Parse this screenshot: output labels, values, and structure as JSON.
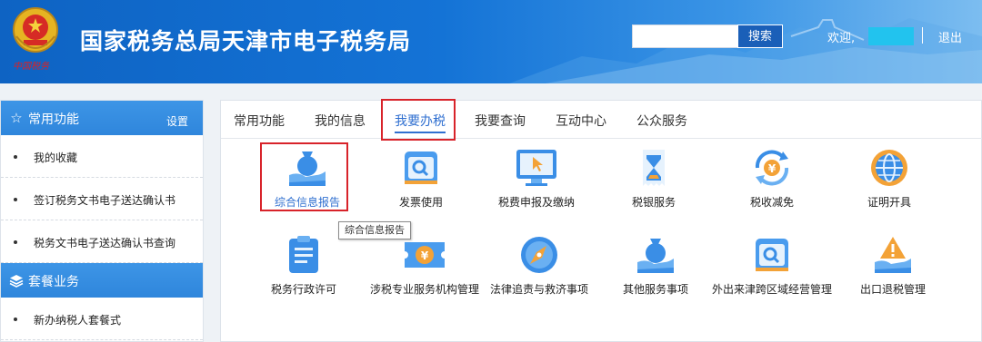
{
  "header": {
    "emblem_text": "中国税务",
    "title": "国家税务总局天津市电子税务局",
    "search_placeholder": "",
    "search_button": "搜索",
    "welcome": "欢迎,",
    "logout": "退出",
    "colors": {
      "primary": "#1473d6",
      "accent": "#22c3ee"
    }
  },
  "sidebar": {
    "sections": [
      {
        "icon": "star-icon",
        "title": "常用功能",
        "action": "设置",
        "items": [
          "我的收藏",
          "签订税务文书电子送达确认书",
          "税务文书电子送达确认书查询"
        ]
      },
      {
        "icon": "layers-icon",
        "title": "套餐业务",
        "items": [
          "新办纳税人套餐式"
        ]
      }
    ]
  },
  "tabs": [
    {
      "label": "常用功能",
      "active": false
    },
    {
      "label": "我的信息",
      "active": false
    },
    {
      "label": "我要办税",
      "active": true
    },
    {
      "label": "我要查询",
      "active": false
    },
    {
      "label": "互动中心",
      "active": false
    },
    {
      "label": "公众服务",
      "active": false
    }
  ],
  "services": [
    {
      "icon": "money-bag-hand-icon",
      "label": "综合信息报告"
    },
    {
      "icon": "invoice-search-icon",
      "label": "发票使用"
    },
    {
      "icon": "monitor-cursor-icon",
      "label": "税费申报及缴纳"
    },
    {
      "icon": "hourglass-receipt-icon",
      "label": "税银服务"
    },
    {
      "icon": "yuan-refresh-icon",
      "label": "税收减免"
    },
    {
      "icon": "globe-certificate-icon",
      "label": "证明开具"
    },
    {
      "icon": "clipboard-icon",
      "label": "税务行政许可"
    },
    {
      "icon": "yuan-ticket-icon",
      "label": "涉税专业服务机构管理"
    },
    {
      "icon": "compass-icon",
      "label": "法律追责与救济事项"
    },
    {
      "icon": "money-bag-hand-icon",
      "label": "其他服务事项"
    },
    {
      "icon": "invoice-search-icon",
      "label": "外出来津跨区域经营管理"
    },
    {
      "icon": "warning-hand-icon",
      "label": "出口退税管理"
    }
  ],
  "tooltip": "综合信息报告"
}
